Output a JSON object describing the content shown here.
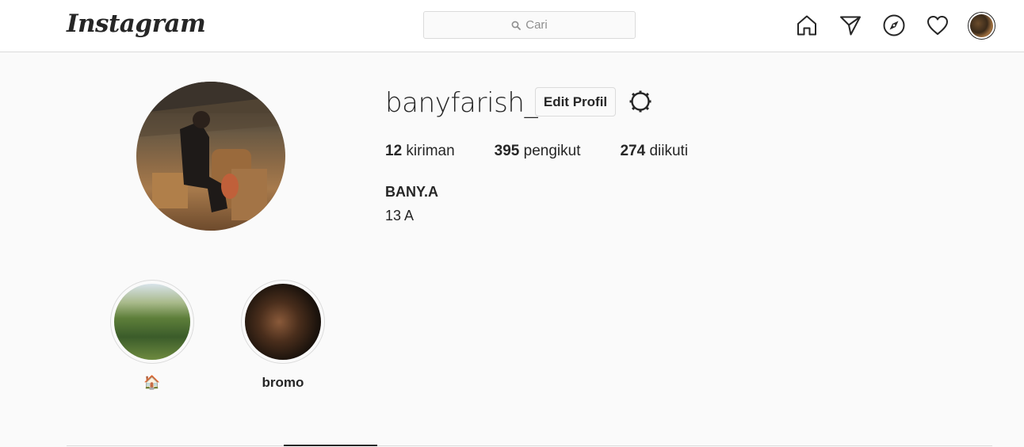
{
  "nav": {
    "logo": "Instagram",
    "search_placeholder": "Cari"
  },
  "profile": {
    "username": "banyfarish_",
    "edit_button": "Edit Profil",
    "stats": [
      {
        "value": "12",
        "label": "kiriman"
      },
      {
        "value": "395",
        "label": "pengikut"
      },
      {
        "value": "274",
        "label": "diikuti"
      }
    ],
    "full_name": "BANY.A",
    "bio": "13 A"
  },
  "highlights": [
    {
      "label": "🏠"
    },
    {
      "label": "bromo"
    }
  ],
  "icons": {
    "home": "home-icon",
    "direct": "paper-plane-icon",
    "explore": "compass-icon",
    "activity": "heart-icon",
    "settings": "gear-icon",
    "search": "search-icon"
  },
  "colors": {
    "background": "#fafafa",
    "border": "#dbdbdb",
    "text": "#262626",
    "muted": "#8e8e8e"
  }
}
